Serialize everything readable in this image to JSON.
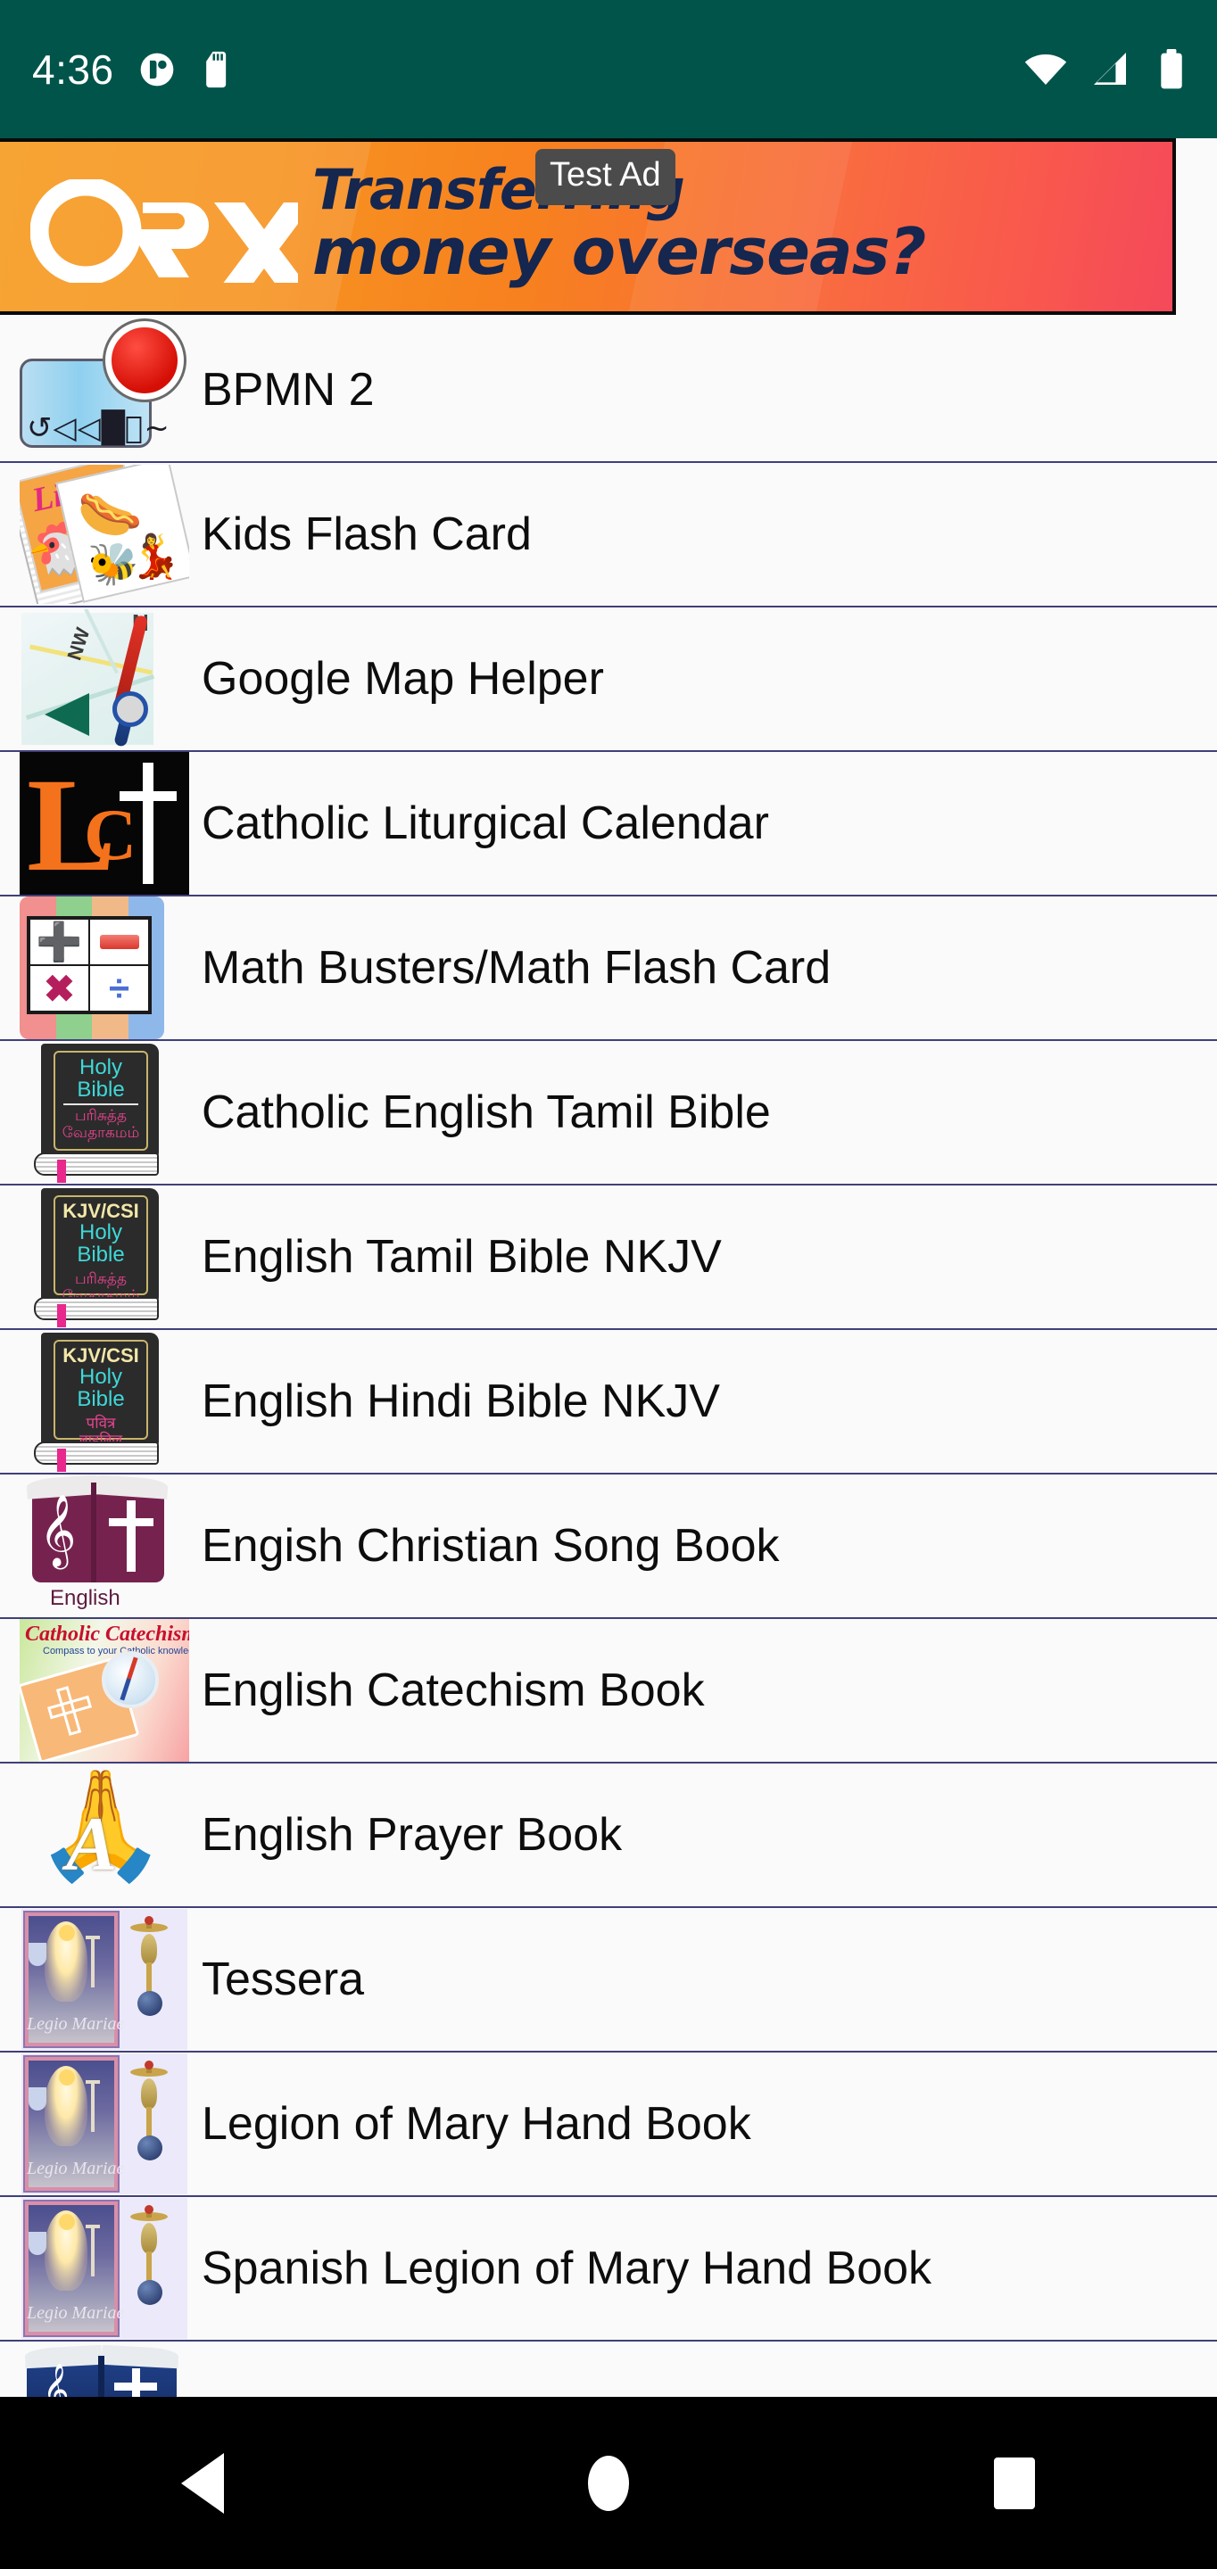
{
  "status_bar": {
    "time": "4:36",
    "left_icons": [
      "do-not-disturb-icon",
      "sd-card-icon"
    ],
    "right_icons": [
      "wifi-icon",
      "cellular-signal-icon",
      "battery-icon"
    ],
    "background_color": "#00544a"
  },
  "ad": {
    "badge_label": "Test Ad",
    "brand": "OFX",
    "headline_line1": "Transferring",
    "headline_line2": "money overseas?",
    "text_color": "#15264f",
    "background_gradient_start": "#f59a1d",
    "background_gradient_end": "#f4495a"
  },
  "list": {
    "items": [
      {
        "label": "BPMN 2",
        "icon": "bpmn-diagram-icon"
      },
      {
        "label": "Kids Flash Card",
        "icon": "flash-cards-icon"
      },
      {
        "label": "Google Map Helper",
        "icon": "compass-map-icon"
      },
      {
        "label": "Catholic Liturgical Calendar",
        "icon": "lc-cross-icon"
      },
      {
        "label": "Math Busters/Math Flash Card",
        "icon": "math-operators-icon"
      },
      {
        "label": "Catholic English Tamil Bible",
        "icon": "holy-bible-tamil-icon",
        "cover": {
          "kjv": "",
          "holy": "Holy",
          "bible": "Bible",
          "native1": "பரிசுத்த",
          "native2": "வேதாகமம்"
        }
      },
      {
        "label": "English Tamil Bible NKJV",
        "icon": "holy-bible-tamil-kjv-icon",
        "cover": {
          "kjv": "KJV/CSI",
          "holy": "Holy",
          "bible": "Bible",
          "native1": "பரிசுத்த",
          "native2": "வேதாகமம்"
        }
      },
      {
        "label": "English Hindi Bible NKJV",
        "icon": "holy-bible-hindi-kjv-icon",
        "cover": {
          "kjv": "KJV/CSI",
          "holy": "Holy",
          "bible": "Bible",
          "native1": "पवित्र",
          "native2": "बाइबिल"
        }
      },
      {
        "label": "Engish Christian Song Book",
        "icon": "song-book-icon",
        "cover": {
          "lang": "English"
        }
      },
      {
        "label": "English Catechism Book",
        "icon": "catechism-book-icon",
        "cover": {
          "title": "Catholic Catechism",
          "subtitle": "Compass to your Catholic knowledge"
        }
      },
      {
        "label": "English Prayer Book",
        "icon": "praying-hands-icon"
      },
      {
        "label": "Tessera",
        "icon": "legion-tessera-icon",
        "cover": {
          "name": "Legio Mariae"
        }
      },
      {
        "label": "Legion of Mary Hand Book",
        "icon": "legion-handbook-icon",
        "cover": {
          "name": "Legio Mariae"
        }
      },
      {
        "label": "Spanish Legion of Mary Hand Book",
        "icon": "legion-handbook-spanish-icon",
        "cover": {
          "name": "Legio Mariae"
        }
      },
      {
        "label": "",
        "icon": "blue-song-book-icon"
      }
    ]
  },
  "navigation_bar": {
    "back_label": "Back",
    "home_label": "Home",
    "recents_label": "Recents",
    "background_color": "#000000"
  }
}
